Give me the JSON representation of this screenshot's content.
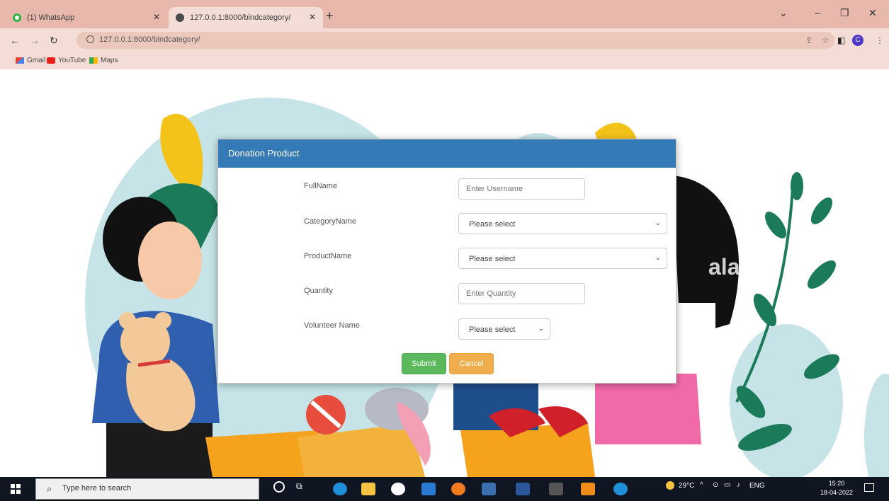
{
  "browser": {
    "tabs": [
      {
        "title": "(1) WhatsApp"
      },
      {
        "title": "127.0.0.1:8000/bindcategory/"
      }
    ],
    "url": "127.0.0.1:8000/bindcategory/",
    "profile_initial": "C",
    "bookmarks": [
      {
        "label": "Gmail"
      },
      {
        "label": "YouTube"
      },
      {
        "label": "Maps"
      }
    ]
  },
  "modal": {
    "title": "Donation Product",
    "fields": {
      "fullname": {
        "label": "FullName",
        "placeholder": "Enter Username"
      },
      "category": {
        "label": "CategoryName",
        "value": "Please select"
      },
      "product": {
        "label": "ProductName",
        "value": "Please select"
      },
      "quantity": {
        "label": "Quantity",
        "placeholder": "Enter Quantity"
      },
      "volunteer": {
        "label": "Volunteer Name",
        "value": "Please select"
      }
    },
    "submit_label": "Submit",
    "cancel_label": "Cancel"
  },
  "taskbar": {
    "search_placeholder": "Type here to search",
    "weather": "29°C",
    "language": "ENG",
    "time": "15:20",
    "date": "18-04-2022"
  },
  "colors": {
    "header": "#337ab7",
    "submit": "#5cb85c",
    "cancel": "#f0ad4e",
    "tabstrip": "#e8b8ac"
  }
}
